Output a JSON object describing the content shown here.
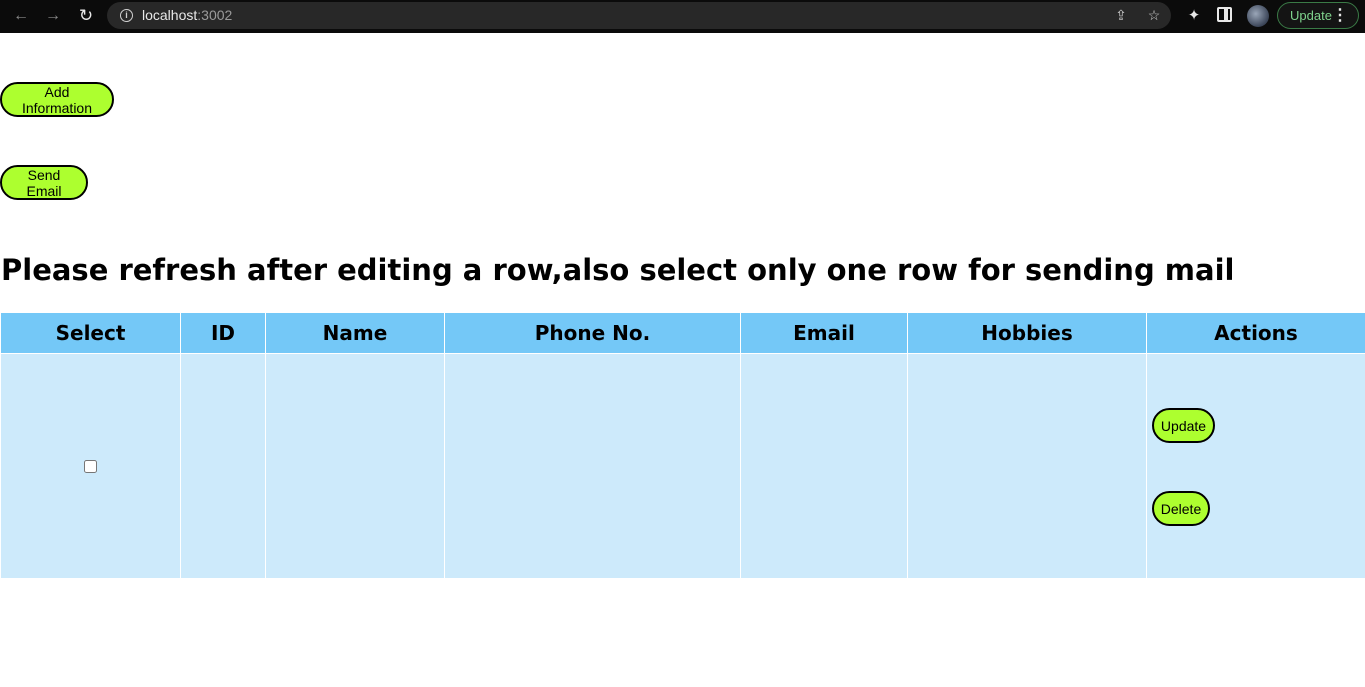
{
  "browser": {
    "url_host": "localhost",
    "url_port": ":3002",
    "update_label": "Update",
    "menu_glyph": "⋮"
  },
  "page": {
    "add_button_label": "Add Information",
    "send_button_label": "Send Email",
    "notice": "Please refresh after editing a row,also select only one row for sending mail"
  },
  "table": {
    "headers": [
      "Select",
      "ID",
      "Name",
      "Phone No.",
      "Email",
      "Hobbies",
      "Actions"
    ],
    "rows": [
      {
        "selected": false,
        "id": "",
        "name": "",
        "phone": "",
        "email": "",
        "hobbies": "",
        "update_label": "Update",
        "delete_label": "Delete"
      }
    ]
  },
  "colors": {
    "button_bg": "#adff2f",
    "header_bg": "#74c8f7",
    "row_bg": "#cdeafb"
  }
}
